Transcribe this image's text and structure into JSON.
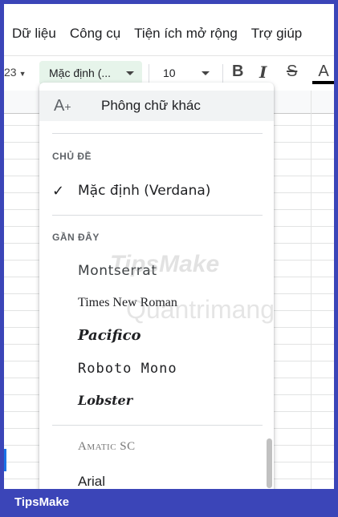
{
  "menubar": {
    "items": [
      "Dữ liệu",
      "Công cụ",
      "Tiện ích mở rộng",
      "Trợ giúp"
    ]
  },
  "toolbar": {
    "partial_label": "23",
    "font_select": "Mặc định (...",
    "font_size": "10",
    "bold": "B",
    "italic": "I",
    "strikethrough": "S",
    "text_color": "A",
    "text_color_value": "#000000"
  },
  "dropdown": {
    "more_fonts": "Phông chữ khác",
    "theme_heading": "CHỦ ĐỀ",
    "theme_font": "Mặc định (Verdana)",
    "recent_heading": "GẦN ĐÂY",
    "recent_fonts": [
      "Montserrat",
      "Times New Roman",
      "Pacifico",
      "Roboto Mono",
      "Lobster"
    ],
    "all_fonts": [
      "Amatic SC",
      "Arial"
    ]
  },
  "watermark": {
    "line1": "TipsMake",
    "line2": "Quantrimang"
  },
  "footer": {
    "brand": "TipsMake"
  },
  "colors": {
    "accent_frame": "#3b45b8",
    "font_select_bg": "#e6f4ea",
    "selection_blue": "#1a73e8"
  }
}
